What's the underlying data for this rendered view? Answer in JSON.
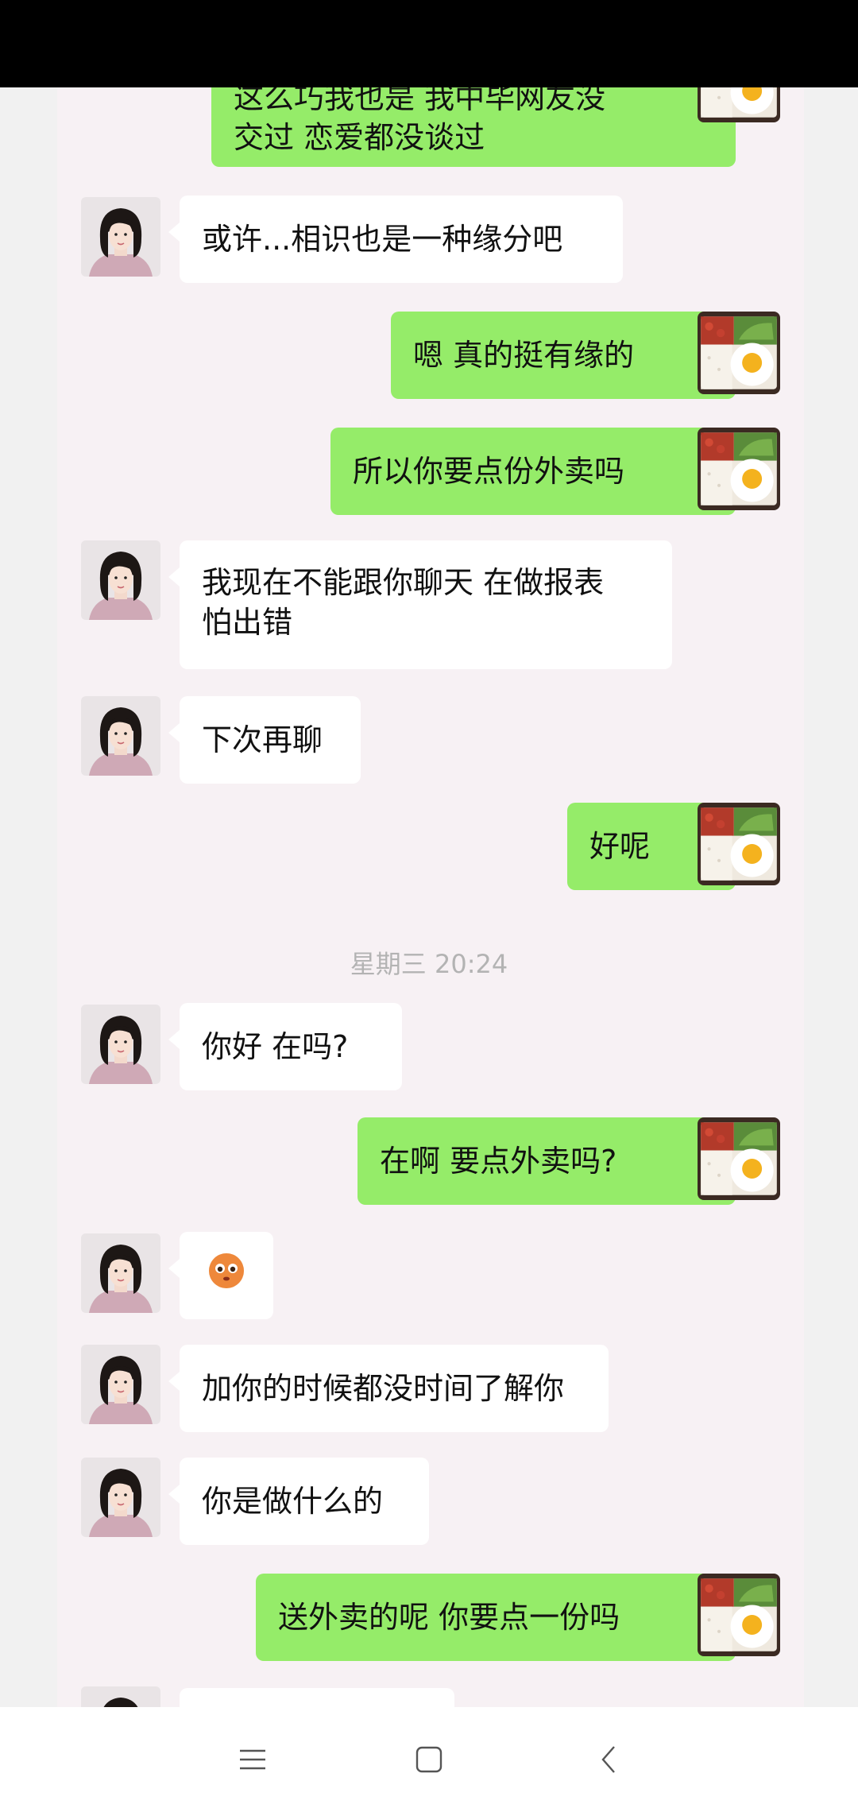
{
  "messages": [
    {
      "side": "out",
      "lines": [
        "这么巧我也是 我中毕网友没",
        "交过 恋爱都没谈过"
      ]
    },
    {
      "side": "in",
      "text": "或许...相识也是一种缘分吧"
    },
    {
      "side": "out",
      "text": "嗯 真的挺有缘的"
    },
    {
      "side": "out",
      "text": "所以你要点份外卖吗"
    },
    {
      "side": "in",
      "lines": [
        "我现在不能跟你聊天 在做报表",
        "怕出错"
      ]
    },
    {
      "side": "in",
      "text": "下次再聊"
    },
    {
      "side": "out",
      "text": "好呢"
    },
    {
      "side": "in",
      "text": "你好 在吗?"
    },
    {
      "side": "out",
      "text": "在啊 要点外卖吗?"
    },
    {
      "side": "in",
      "emoji": "blush-emoji"
    },
    {
      "side": "in",
      "text": "加你的时候都没时间了解你"
    },
    {
      "side": "in",
      "text": "你是做什么的"
    },
    {
      "side": "out",
      "text": "送外卖的呢 你要点一份吗"
    }
  ],
  "timestamp": "星期三 20:24",
  "colors": {
    "outgoing_bubble": "#95ec69",
    "incoming_bubble": "#ffffff",
    "chat_background": "#f7f1f4"
  },
  "icons": {
    "contact_avatar": "woman-portrait",
    "self_avatar": "food-bento",
    "nav": [
      "menu-icon",
      "home-square-icon",
      "back-chevron-icon"
    ]
  }
}
